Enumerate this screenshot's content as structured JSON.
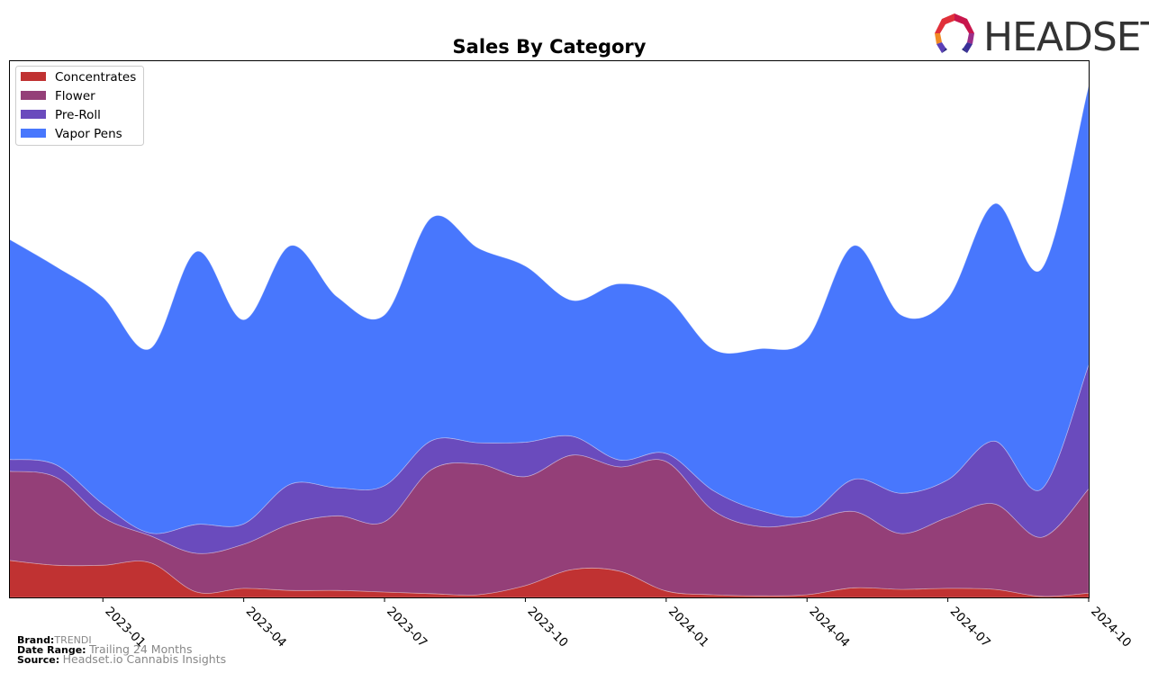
{
  "header": {
    "logo_text": "HEADSET",
    "logo_icon": "headset-logo-icon"
  },
  "footer": {
    "brand_label": "Brand:",
    "brand_value": "TRENDI",
    "date_range_label": "Date Range:",
    "date_range_value": "Trailing 24 Months",
    "source_label": "Source:",
    "source_value": "Headset.io Cannabis Insights"
  },
  "chart_data": {
    "type": "area",
    "stacked": true,
    "smoothed": true,
    "title": "Sales By Category",
    "xlabel": "",
    "ylabel": "",
    "x": [
      "2022-11",
      "2022-12",
      "2023-01",
      "2023-02",
      "2023-03",
      "2023-04",
      "2023-05",
      "2023-06",
      "2023-07",
      "2023-08",
      "2023-09",
      "2023-10",
      "2023-11",
      "2023-12",
      "2024-01",
      "2024-02",
      "2024-03",
      "2024-04",
      "2024-05",
      "2024-06",
      "2024-07",
      "2024-08",
      "2024-09",
      "2024-10"
    ],
    "xticks": [
      "2023-01",
      "2023-04",
      "2023-07",
      "2023-10",
      "2024-01",
      "2024-04",
      "2024-07",
      "2024-10"
    ],
    "ylim": [
      0,
      100
    ],
    "yticks_visible": false,
    "grid": false,
    "legend_position": "top-left",
    "series": [
      {
        "name": "Concentrates",
        "color": "#c03232",
        "values": [
          6.9,
          6.0,
          6.0,
          6.5,
          1.0,
          1.7,
          1.3,
          1.3,
          1.0,
          0.7,
          0.5,
          2.2,
          5.2,
          4.9,
          1.2,
          0.5,
          0.3,
          0.5,
          1.8,
          1.5,
          1.7,
          1.5,
          0.2,
          0.8
        ]
      },
      {
        "name": "Flower",
        "color": "#943f78",
        "values": [
          16.6,
          16.4,
          8.9,
          5.0,
          7.2,
          8.2,
          12.4,
          13.9,
          13.1,
          23.1,
          24.3,
          20.3,
          21.3,
          19.4,
          24.1,
          15.7,
          12.9,
          13.6,
          14.2,
          10.4,
          13.2,
          15.9,
          11.0,
          19.4
        ]
      },
      {
        "name": "Pre-Roll",
        "color": "#6a4bbd",
        "values": [
          2.2,
          2.3,
          2.5,
          0.5,
          5.4,
          3.8,
          7.4,
          5.2,
          6.7,
          5.4,
          4.0,
          6.4,
          3.5,
          1.3,
          1.5,
          3.7,
          3.0,
          1.2,
          6.0,
          7.5,
          7.0,
          11.7,
          9.0,
          23.1
        ]
      },
      {
        "name": "Vapor Pens",
        "color": "#4877fd",
        "values": [
          41.0,
          36.9,
          38.5,
          34.3,
          50.8,
          38.0,
          44.4,
          35.5,
          31.8,
          41.5,
          36.2,
          32.8,
          25.3,
          32.8,
          29.1,
          26.3,
          30.1,
          32.8,
          43.5,
          33.2,
          33.8,
          44.2,
          41.0,
          51.9
        ]
      }
    ]
  }
}
